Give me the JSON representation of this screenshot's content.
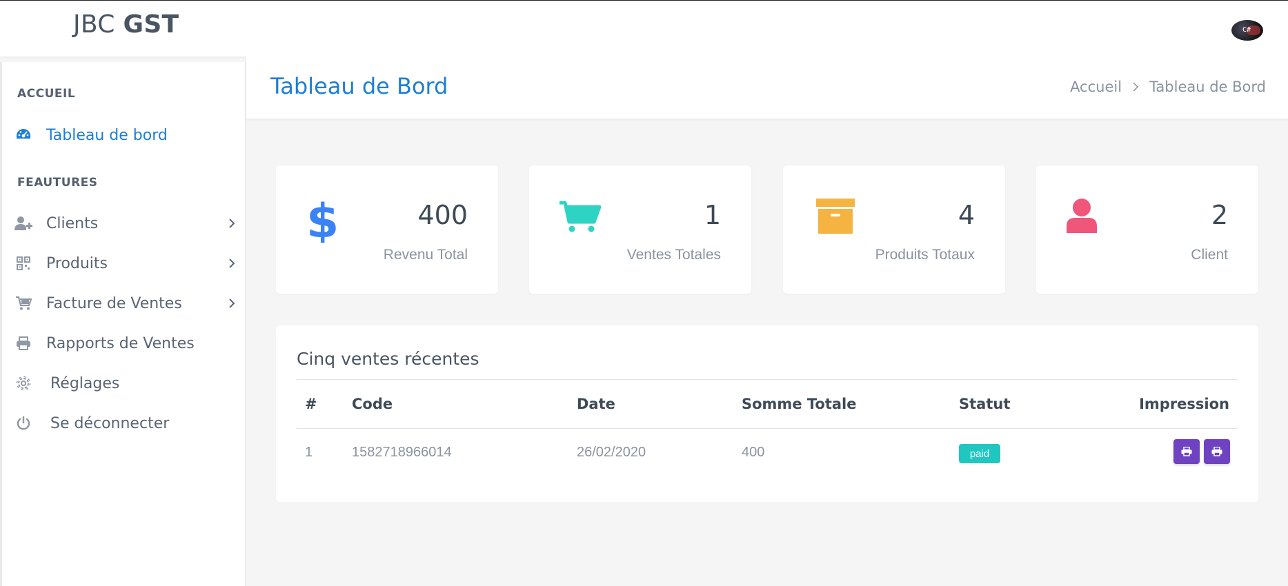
{
  "header": {
    "brand_light": "JBC ",
    "brand_bold": "GST",
    "avatar_text": "C#"
  },
  "sidebar": {
    "sections": [
      "ACCUEIL",
      "FEAUTURES"
    ],
    "items": [
      {
        "label": "Tableau de bord",
        "icon": "dashboard-icon",
        "active": true
      },
      {
        "label": "Clients",
        "icon": "user-plus-icon",
        "has_children": true
      },
      {
        "label": "Produits",
        "icon": "qrcode-icon",
        "has_children": true
      },
      {
        "label": "Facture de Ventes",
        "icon": "cart-icon",
        "has_children": true
      },
      {
        "label": "Rapports de Ventes",
        "icon": "printer-icon"
      },
      {
        "label": "Réglages",
        "icon": "gear-icon"
      },
      {
        "label": "Se déconnecter",
        "icon": "power-icon"
      }
    ]
  },
  "page": {
    "title": "Tableau de Bord",
    "breadcrumb": [
      "Accueil",
      "Tableau de Bord"
    ]
  },
  "stats": [
    {
      "value": "400",
      "label": "Revenu Total",
      "icon": "dollar-icon",
      "color": "#3b82f6"
    },
    {
      "value": "1",
      "label": "Ventes Totales",
      "icon": "cart-icon",
      "color": "#2dd4c4"
    },
    {
      "value": "4",
      "label": "Produits Totaux",
      "icon": "archive-box-icon",
      "color": "#f5b342"
    },
    {
      "value": "2",
      "label": "Client",
      "icon": "user-icon",
      "color": "#f0567a"
    }
  ],
  "recent_sales": {
    "title": "Cinq ventes récentes",
    "columns": [
      "#",
      "Code",
      "Date",
      "Somme Totale",
      "Statut",
      "Impression"
    ],
    "rows": [
      {
        "num": "1",
        "code": "1582718966014",
        "date": "26/02/2020",
        "total": "400",
        "status": "paid"
      }
    ]
  },
  "colors": {
    "accent": "#1c7ed6",
    "status_paid": "#20c7c0",
    "print_button": "#6f42c1"
  }
}
